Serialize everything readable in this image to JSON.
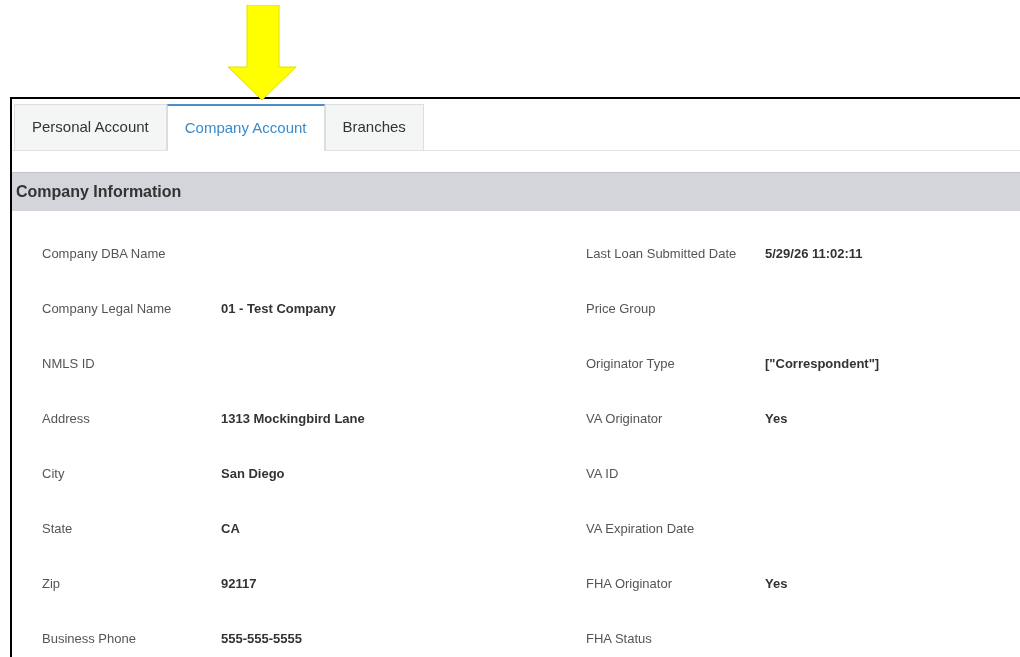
{
  "tabs": [
    {
      "label": "Personal Account",
      "selected": false
    },
    {
      "label": "Company Account",
      "selected": true
    },
    {
      "label": "Branches",
      "selected": false
    }
  ],
  "section": {
    "title": "Company Information"
  },
  "left_fields": [
    {
      "label": "Company DBA Name"
    },
    {
      "label": "Company Legal Name",
      "value": "01 - Test Company"
    },
    {
      "label": "NMLS ID"
    },
    {
      "label": "Address",
      "value": "1313 Mockingbird Lane"
    },
    {
      "label": "City",
      "value": "San Diego"
    },
    {
      "label": "State",
      "value": "CA"
    },
    {
      "label": "Zip",
      "value": "92117"
    },
    {
      "label": "Business Phone",
      "value": "555-555-5555"
    }
  ],
  "right_fields": [
    {
      "label": "Last Loan Submitted Date",
      "value": "5/29/26 11:02:11"
    },
    {
      "label": "Price Group"
    },
    {
      "label": "Originator Type",
      "value": "[\"Correspondent\"]"
    },
    {
      "label": "VA Originator",
      "value": "Yes"
    },
    {
      "label": "VA ID"
    },
    {
      "label": "VA Expiration Date"
    },
    {
      "label": "FHA Originator",
      "value": "Yes"
    },
    {
      "label": "FHA Status"
    }
  ]
}
